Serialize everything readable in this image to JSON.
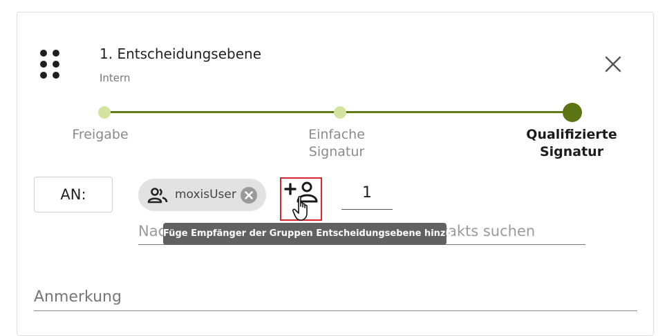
{
  "level": {
    "title": "1. Entscheidungsebene",
    "subtitle": "Intern"
  },
  "stepper": {
    "steps": [
      {
        "label": "Freigabe",
        "active": false
      },
      {
        "label": "Einfache Signatur",
        "active": false
      },
      {
        "label": "Qualifizierte Signatur",
        "active": true
      }
    ],
    "accent_color": "#5e7a12",
    "inactive_dot_color": "#d3e49e"
  },
  "recipients": {
    "to_label": "AN:",
    "chip_label": "moxisUser",
    "count": "1",
    "search_placeholder": "Nach Namen oder E-Mail-Adresse des Kontakts suchen",
    "add_group_tooltip": "Füge Empfänger der Gruppen Entscheidungsebene hinzu",
    "highlight_color": "#d9252a"
  },
  "note": {
    "placeholder": "Anmerkung"
  },
  "icons": {
    "drag": "drag-handle-icon",
    "close": "close-icon",
    "group": "group-icon",
    "chip_remove": "remove-circle-icon",
    "add_group": "add-person-icon",
    "cursor": "hand-pointer-icon"
  }
}
